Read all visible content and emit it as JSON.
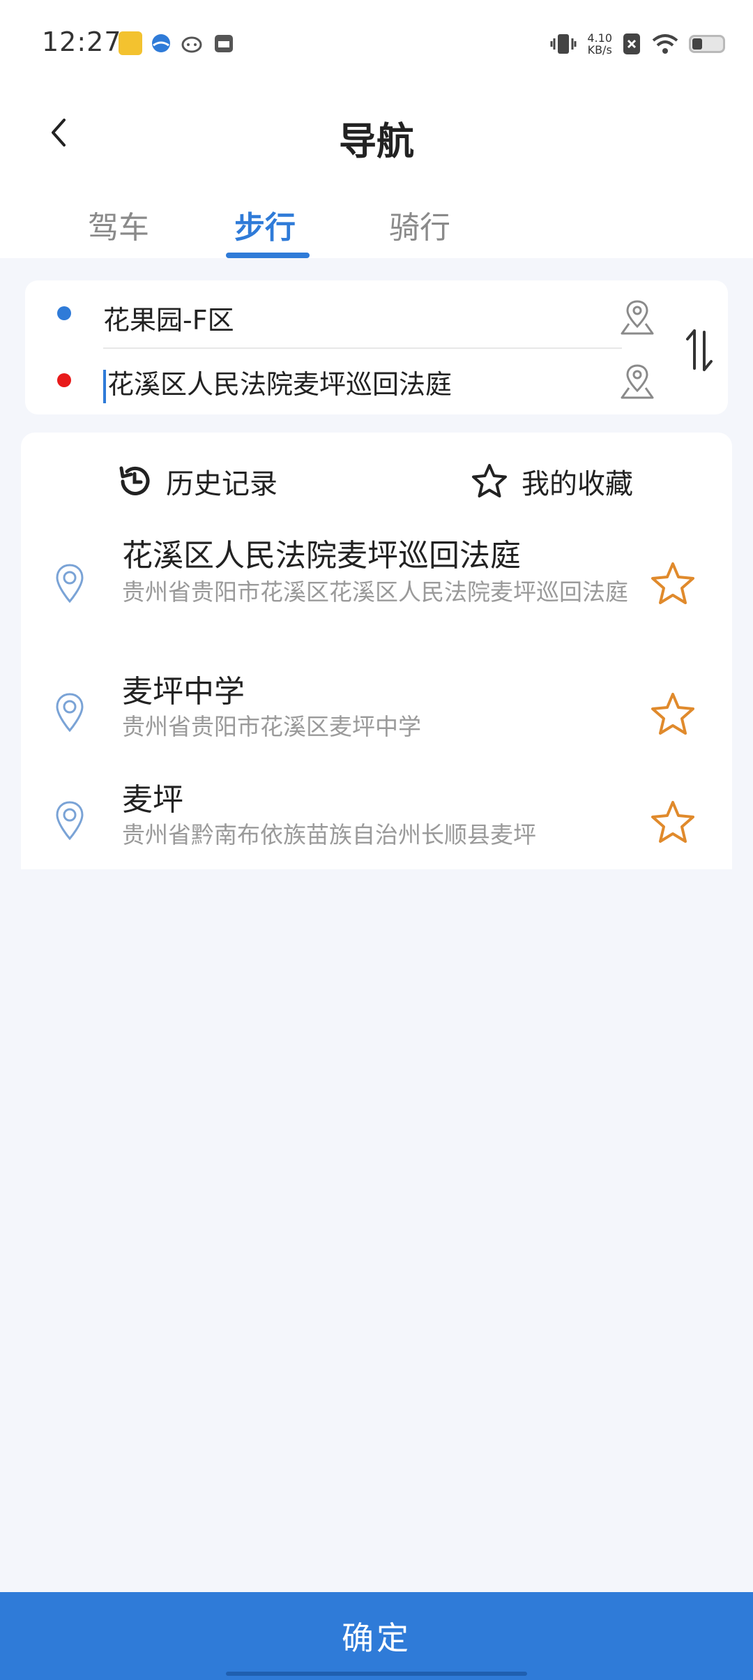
{
  "status_bar": {
    "time": "12:27",
    "net_speed_value": "4.10",
    "net_speed_unit": "KB/s",
    "icons": [
      "app-notification-icon",
      "globe-icon",
      "cat-app-icon",
      "mail-app-icon",
      "vibrate-icon",
      "sim-off-icon",
      "wifi-icon",
      "battery-icon"
    ]
  },
  "header": {
    "title": "导航",
    "back_icon": "chevron-left-icon"
  },
  "tabs": [
    {
      "label": "驾车",
      "active": false
    },
    {
      "label": "步行",
      "active": true
    },
    {
      "label": "骑行",
      "active": false
    }
  ],
  "route": {
    "origin": "花果园-F区",
    "destination": "花溪区人民法院麦坪巡回法庭",
    "origin_color": "#2f7bd8",
    "destination_color": "#e81a1a"
  },
  "history_panel": {
    "history_label": "历史记录",
    "favorites_label": "我的收藏",
    "items": [
      {
        "title": "花溪区人民法院麦坪巡回法庭",
        "address": "贵州省贵阳市花溪区花溪区人民法院麦坪巡回法庭"
      },
      {
        "title": "麦坪中学",
        "address": "贵州省贵阳市花溪区麦坪中学"
      },
      {
        "title": "麦坪",
        "address": "贵州省黔南布依族苗族自治州长顺县麦坪"
      }
    ]
  },
  "confirm_button": {
    "label": "确定"
  },
  "colors": {
    "accent": "#2f7bd8",
    "star": "#e08a2c",
    "background": "#f4f6fb"
  }
}
